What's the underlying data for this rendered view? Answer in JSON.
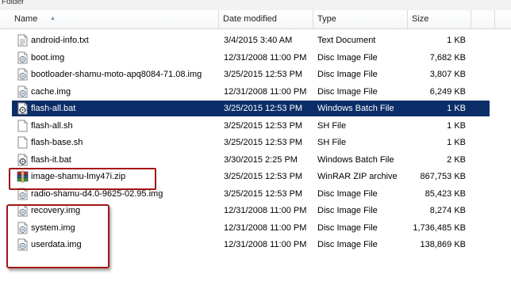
{
  "window": {
    "top_label": "Folder"
  },
  "columns": {
    "name": "Name",
    "date": "Date modified",
    "type": "Type",
    "size": "Size"
  },
  "files": [
    {
      "name": "android-info.txt",
      "date": "3/4/2015 3:40 AM",
      "type": "Text Document",
      "size": "1 KB",
      "icon": "text-file-icon"
    },
    {
      "name": "boot.img",
      "date": "12/31/2008 11:00 PM",
      "type": "Disc Image File",
      "size": "7,682 KB",
      "icon": "disc-image-icon"
    },
    {
      "name": "bootloader-shamu-moto-apq8084-71.08.img",
      "date": "3/25/2015 12:53 PM",
      "type": "Disc Image File",
      "size": "3,807 KB",
      "icon": "disc-image-icon"
    },
    {
      "name": "cache.img",
      "date": "12/31/2008 11:00 PM",
      "type": "Disc Image File",
      "size": "6,249 KB",
      "icon": "disc-image-icon"
    },
    {
      "name": "flash-all.bat",
      "date": "3/25/2015 12:53 PM",
      "type": "Windows Batch File",
      "size": "1 KB",
      "icon": "batch-file-icon",
      "selected": true
    },
    {
      "name": "flash-all.sh",
      "date": "3/25/2015 12:53 PM",
      "type": "SH File",
      "size": "1 KB",
      "icon": "blank-file-icon"
    },
    {
      "name": "flash-base.sh",
      "date": "3/25/2015 12:53 PM",
      "type": "SH File",
      "size": "1 KB",
      "icon": "blank-file-icon"
    },
    {
      "name": "flash-it.bat",
      "date": "3/30/2015 2:25 PM",
      "type": "Windows Batch File",
      "size": "2 KB",
      "icon": "batch-file-icon"
    },
    {
      "name": "image-shamu-lmy47i.zip",
      "date": "3/25/2015 12:53 PM",
      "type": "WinRAR ZIP archive",
      "size": "867,753 KB",
      "icon": "winrar-archive-icon"
    },
    {
      "name": "radio-shamu-d4.0-9625-02.95.img",
      "date": "3/25/2015 12:53 PM",
      "type": "Disc Image File",
      "size": "85,423 KB",
      "icon": "disc-image-icon"
    },
    {
      "name": "recovery.img",
      "date": "12/31/2008 11:00 PM",
      "type": "Disc Image File",
      "size": "8,274 KB",
      "icon": "disc-image-icon"
    },
    {
      "name": "system.img",
      "date": "12/31/2008 11:00 PM",
      "type": "Disc Image File",
      "size": "1,736,485 KB",
      "icon": "disc-image-icon"
    },
    {
      "name": "userdata.img",
      "date": "12/31/2008 11:00 PM",
      "type": "Disc Image File",
      "size": "138,869 KB",
      "icon": "disc-image-icon"
    }
  ],
  "colors": {
    "selection": "#0c2e68",
    "annotation": "#a31515"
  }
}
